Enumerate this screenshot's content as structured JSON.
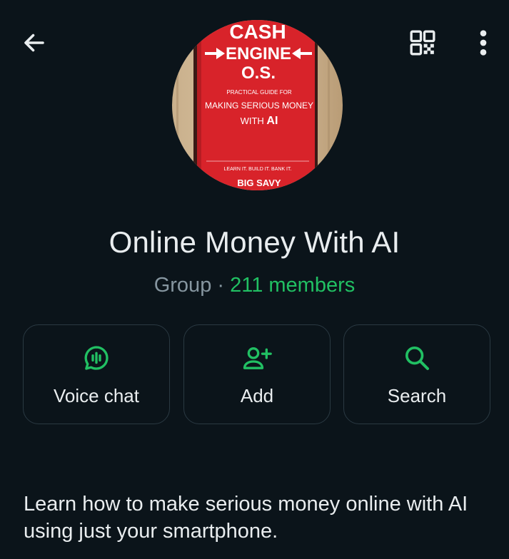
{
  "colors": {
    "background": "#0b141a",
    "accent": "#21c063",
    "text_primary": "#e9edef",
    "text_secondary": "#8696a0",
    "card_border": "#2a3942"
  },
  "topbar": {
    "back_icon": "arrow-left-icon",
    "qr_icon": "qr-code-icon",
    "more_icon": "more-vertical-icon"
  },
  "avatar": {
    "title_line1": "CASH",
    "title_line2": "ENGINE",
    "title_line3": "O.S.",
    "subtitle_line1": "PRACTICAL GUIDE FOR",
    "subtitle_line2": "MAKING SERIOUS MONEY",
    "subtitle_line3_prefix": "WITH ",
    "subtitle_line3_bold": "AI",
    "tagline": "LEARN IT. BUILD IT. BANK IT.",
    "author": "BIG SAVY"
  },
  "group": {
    "name": "Online Money With AI",
    "type": "Group",
    "separator": " · ",
    "members": "211 members"
  },
  "actions": [
    {
      "label": "Voice chat",
      "icon": "voice-chat-icon"
    },
    {
      "label": "Add",
      "icon": "add-person-icon"
    },
    {
      "label": "Search",
      "icon": "search-icon"
    }
  ],
  "description": "Learn how to make serious money online with AI using just your smartphone."
}
